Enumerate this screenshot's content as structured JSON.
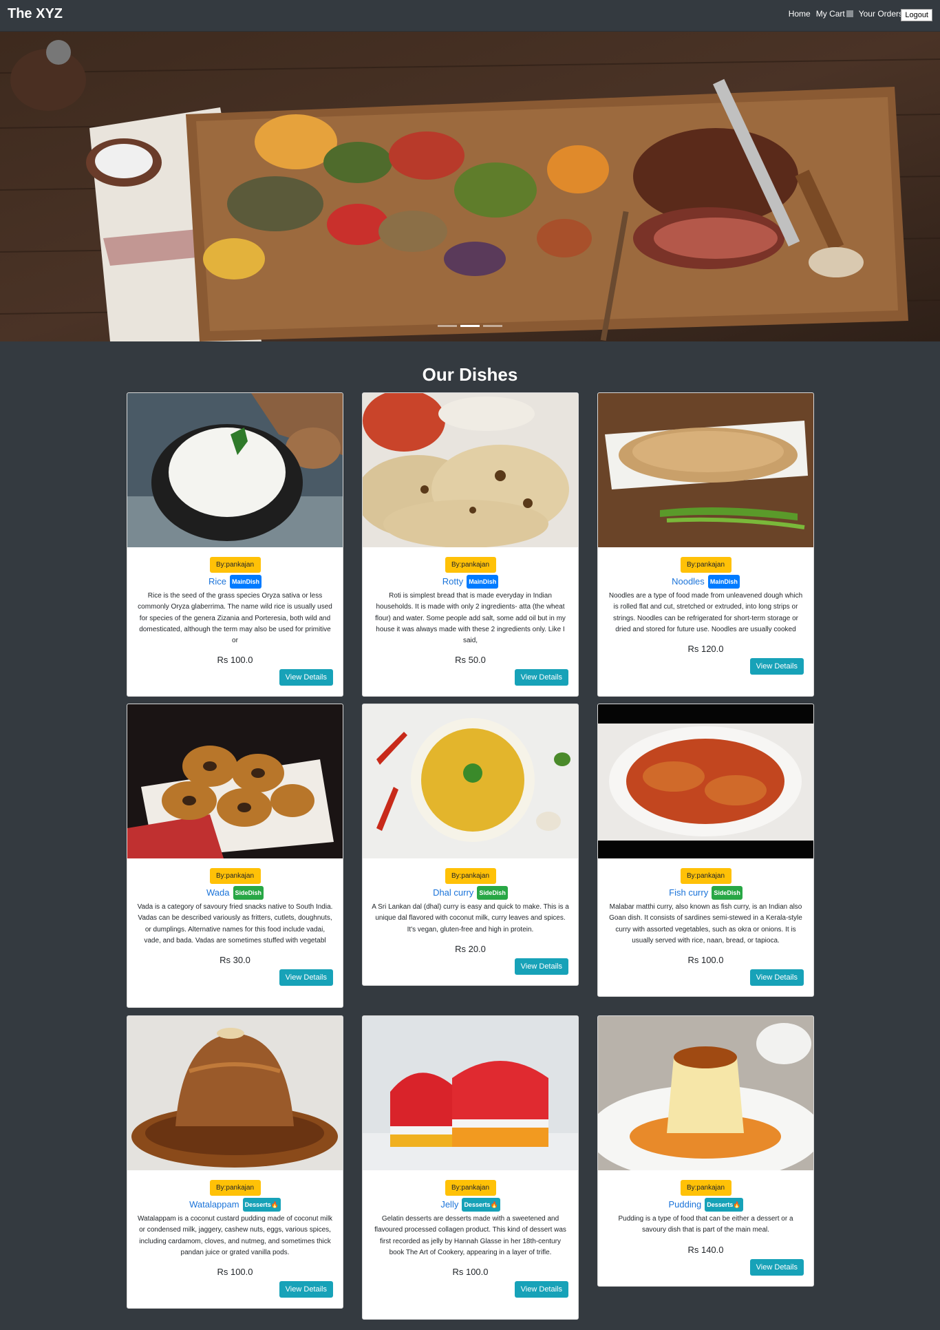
{
  "navbar": {
    "brand": "The XYZ",
    "home": "Home",
    "cart": "My Cart",
    "orders": "Your Orders",
    "logout": "Logout"
  },
  "section": {
    "title": "Our Dishes"
  },
  "card_action": "View Details",
  "dishes": [
    {
      "author": "By:pankajan",
      "name": "Rice",
      "category": "MainDish",
      "price": "Rs 100.0",
      "description": "Rice is the seed of the grass species Oryza sativa or less commonly Oryza glaberrima. The name wild rice is usually used for species of the genera Zizania and Porteresia, both wild and domesticated, although the term may also be used for primitive or"
    },
    {
      "author": "By:pankajan",
      "name": "Rotty",
      "category": "MainDish",
      "price": "Rs 50.0",
      "description": "Roti is simplest bread that is made everyday in Indian households. It is made with only 2 ingredients- atta (the wheat flour) and water. Some people add salt, some add oil but in my house it was always made with these 2 ingredients only. Like I said,"
    },
    {
      "author": "By:pankajan",
      "name": "Noodles",
      "category": "MainDish",
      "price": "Rs 120.0",
      "description": "Noodles are a type of food made from unleavened dough which is rolled flat and cut, stretched or extruded, into long strips or strings. Noodles can be refrigerated for short-term storage or dried and stored for future use. Noodles are usually cooked"
    },
    {
      "author": "By:pankajan",
      "name": "Wada",
      "category": "SideDish",
      "price": "Rs 30.0",
      "description": "Vada is a category of savoury fried snacks native to South India. Vadas can be described variously as fritters, cutlets, doughnuts, or dumplings. Alternative names for this food include vadai, vade, and bada. Vadas are sometimes stuffed with vegetabl"
    },
    {
      "author": "By:pankajan",
      "name": "Dhal curry",
      "category": "SideDish",
      "price": "Rs 20.0",
      "description": "A Sri Lankan dal (dhal) curry is easy and quick to make. This is a unique dal flavored with coconut milk, curry leaves and spices. It's vegan, gluten-free and high in protein."
    },
    {
      "author": "By:pankajan",
      "name": "Fish curry",
      "category": "SideDish",
      "price": "Rs 100.0",
      "description": "Malabar matthi curry, also known as fish curry, is an Indian also Goan dish. It consists of sardines semi-stewed in a Kerala-style curry with assorted vegetables, such as okra or onions. It is usually served with rice, naan, bread, or tapioca."
    },
    {
      "author": "By:pankajan",
      "name": "Watalappam",
      "category": "Desserts🔥",
      "price": "Rs 100.0",
      "description": "Watalappam is a coconut custard pudding made of coconut milk or condensed milk, jaggery, cashew nuts, eggs, various spices, including cardamom, cloves, and nutmeg, and sometimes thick pandan juice or grated vanilla pods."
    },
    {
      "author": "By:pankajan",
      "name": "Jelly",
      "category": "Desserts🔥",
      "price": "Rs 100.0",
      "description": "Gelatin desserts are desserts made with a sweetened and flavoured processed collagen product. This kind of dessert was first recorded as jelly by Hannah Glasse in her 18th-century book The Art of Cookery, appearing in a layer of trifle."
    },
    {
      "author": "By:pankajan",
      "name": "Pudding",
      "category": "Desserts🔥",
      "price": "Rs 140.0",
      "description": "Pudding is a type of food that can be either a dessert or a savoury dish that is part of the main meal."
    }
  ]
}
